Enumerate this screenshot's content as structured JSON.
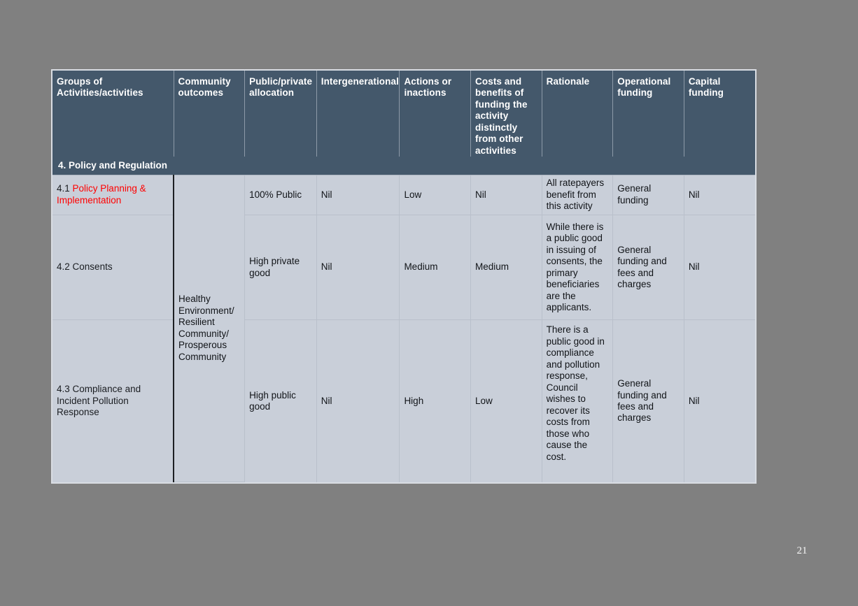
{
  "slide": {
    "page_number": "21",
    "background_color": "#808080",
    "header_color": "#44586b",
    "body_cell_color": "#c9cfd9",
    "merged_cell_color": "#808080",
    "accent_red": "#ff0000"
  },
  "table": {
    "headers": [
      "Groups of Activities/activities",
      "Community outcomes",
      "Public/private allocation",
      "Intergenerational",
      "Actions or inactions",
      "Costs and benefits of funding the activity distinctly from other activities",
      "Rationale",
      "Operational funding",
      "Capital funding"
    ],
    "section_title": "4. Policy and Regulation",
    "community_outcomes_merged": "Healthy Environment/ Resilient Community/ Prosperous Community",
    "rows": [
      {
        "number": "4.1",
        "activity": "Policy Planning & Implementation",
        "activity_highlight": true,
        "public_private_allocation": "100% Public",
        "intergenerational": "Nil",
        "actions_or_inactions": "Low",
        "costs_and_benefits": "Nil",
        "rationale": "All ratepayers benefit from this activity",
        "operational_funding": "General funding",
        "capital_funding": "Nil"
      },
      {
        "number": "4.2",
        "activity": "Consents",
        "activity_highlight": false,
        "public_private_allocation": "High private good",
        "intergenerational": "Nil",
        "actions_or_inactions": "Medium",
        "costs_and_benefits": "Medium",
        "rationale": "While there is a public good in issuing of consents, the primary beneficiaries are the applicants.",
        "operational_funding": "General funding and fees and charges",
        "capital_funding": "Nil"
      },
      {
        "number": "4.3",
        "activity": "Compliance and Incident Pollution Response",
        "activity_highlight": false,
        "public_private_allocation": "High public good",
        "intergenerational": "Nil",
        "actions_or_inactions": "High",
        "costs_and_benefits": "Low",
        "rationale": "There is a public good in compliance and pollution response, Council wishes to recover its costs from those who cause the cost.",
        "operational_funding": "General funding and fees and charges",
        "capital_funding": "Nil"
      }
    ]
  }
}
